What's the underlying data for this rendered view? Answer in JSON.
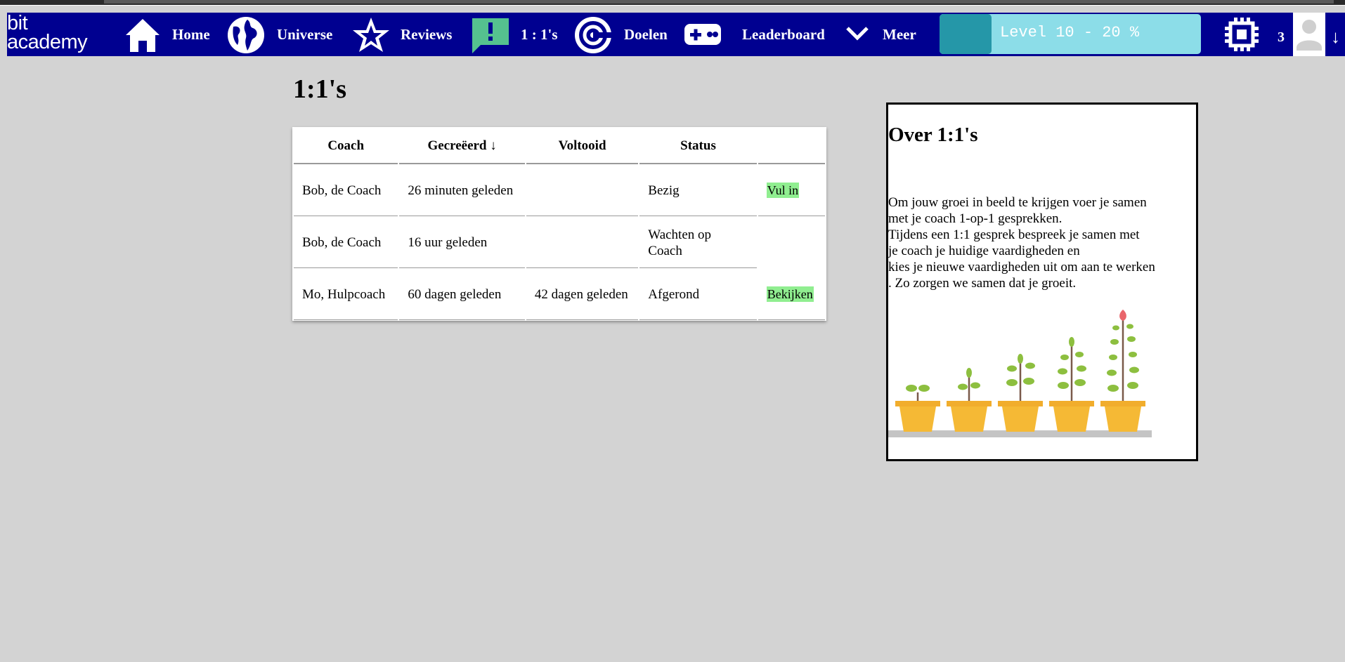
{
  "nav": {
    "logo_line1": "bit",
    "logo_line2": "academy",
    "items": [
      {
        "label": "Home",
        "icon": "home-icon"
      },
      {
        "label": "Universe",
        "icon": "globe-icon"
      },
      {
        "label": "Reviews",
        "icon": "star-icon"
      },
      {
        "label": "1 : 1's",
        "icon": "chat-alert-icon"
      },
      {
        "label": "Doelen",
        "icon": "target-icon"
      },
      {
        "label": "Leaderboard",
        "icon": "gamepad-icon"
      },
      {
        "label": "Meer",
        "icon": "chevron-down-icon"
      }
    ],
    "level_text": "Level 10 - 20 %",
    "level_progress": 0.2,
    "count": "3",
    "scroll_arrow": "↓"
  },
  "page": {
    "title": "1:1's"
  },
  "table": {
    "headers": [
      "Coach",
      "Gecreëerd ↓",
      "Voltooid",
      "Status"
    ],
    "rows": [
      {
        "coach": "Bob, de Coach",
        "created": "26 minuten geleden",
        "completed": "",
        "status": "Bezig",
        "action": "Vul in"
      },
      {
        "coach": "Bob, de Coach",
        "created": "16 uur geleden",
        "completed": "",
        "status": "Wachten op Coach",
        "action": ""
      },
      {
        "coach": "Mo, Hulpcoach",
        "created": "60 dagen geleden",
        "completed": "42 dagen geleden",
        "status": "Afgerond",
        "action": "Bekijken"
      }
    ]
  },
  "about": {
    "title": "Over 1:1's",
    "lines": [
      "Om jouw groei in beeld te krijgen voer je samen",
      "met je coach 1-op-1 gesprekken.",
      "Tijdens een 1:1 gesprek bespreek je samen met",
      "je coach je huidige vaardigheden en",
      "kies je nieuwe vaardigheden uit om aan te werken",
      ". Zo zorgen we samen dat je groeit."
    ]
  },
  "colors": {
    "navbar": "#000090",
    "background": "#d3d3d3",
    "level_bar": "#8cdde8",
    "level_fill": "#2597a8",
    "action_green": "#90ee90",
    "chat_icon": "#55c18f"
  }
}
